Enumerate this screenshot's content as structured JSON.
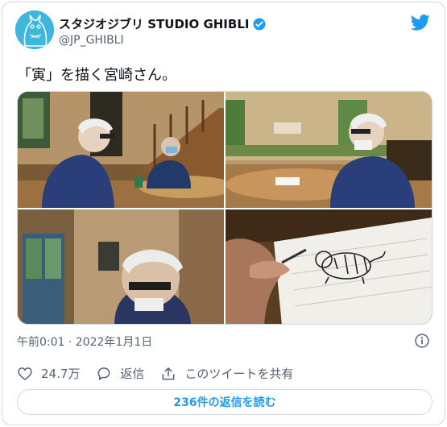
{
  "tweet": {
    "author": {
      "display_name": "スタジオジブリ STUDIO GHIBLI",
      "handle": "@JP_GHIBLI",
      "verified": true
    },
    "text": "「寅」を描く宮崎さん。",
    "timestamp": "午前0:01 · 2022年1月1日",
    "likes": "24.7万",
    "reply_label": "返信",
    "share_label": "このツイートを共有",
    "read_replies_label": "236件の返信を読む"
  },
  "icons": {
    "like": "heart-icon",
    "reply": "reply-bubble-icon",
    "share": "share-upload-icon",
    "info": "info-icon",
    "logo": "twitter-bird-icon",
    "verified": "verified-badge-icon"
  },
  "colors": {
    "accent": "#1d9bf0",
    "text": "#0f1419",
    "secondary": "#536471",
    "border": "#cfd9de",
    "avatar_bg": "#3fb7dc"
  }
}
